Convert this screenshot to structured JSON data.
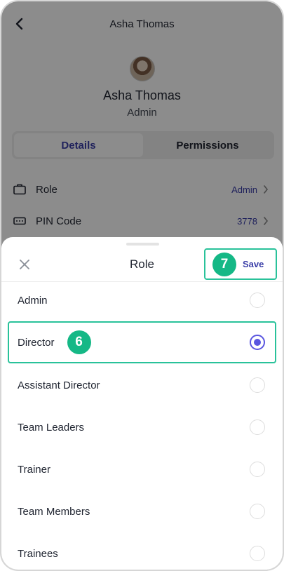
{
  "header": {
    "title": "Asha Thomas"
  },
  "profile": {
    "name": "Asha Thomas",
    "role": "Admin"
  },
  "tabs": [
    {
      "label": "Details",
      "active": true
    },
    {
      "label": "Permissions",
      "active": false
    }
  ],
  "info_rows": [
    {
      "label": "Role",
      "value": "Admin",
      "icon": "briefcase-icon"
    },
    {
      "label": "PIN Code",
      "value": "3778",
      "icon": "keypad-icon"
    }
  ],
  "sheet": {
    "title": "Role",
    "save_label": "Save",
    "save_step": "7",
    "options": [
      {
        "label": "Admin",
        "selected": false
      },
      {
        "label": "Director",
        "selected": true,
        "step": "6"
      },
      {
        "label": "Assistant Director",
        "selected": false
      },
      {
        "label": "Team Leaders",
        "selected": false
      },
      {
        "label": "Trainer",
        "selected": false
      },
      {
        "label": "Team Members",
        "selected": false
      },
      {
        "label": "Trainees",
        "selected": false
      }
    ]
  },
  "colors": {
    "accent": "#3b3fa8",
    "radio_selected": "#5a56e0",
    "highlight": "#29c29a",
    "badge": "#15b886"
  }
}
